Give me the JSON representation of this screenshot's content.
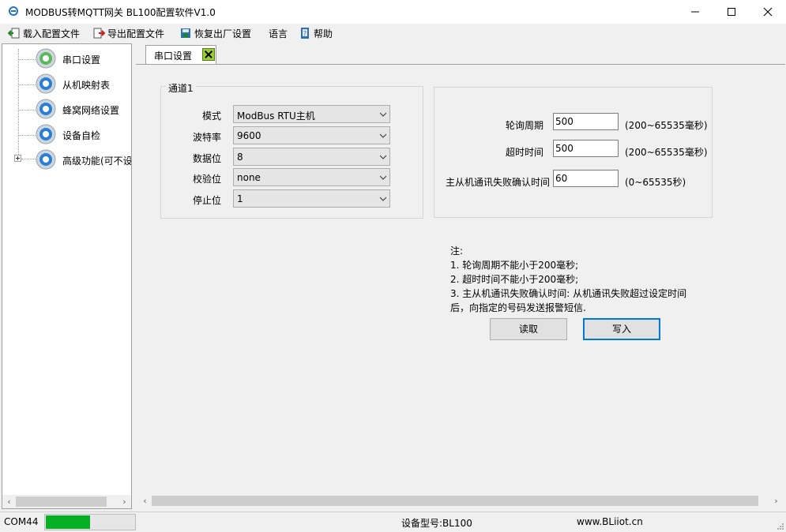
{
  "window": {
    "title": "MODBUS转MQTT网关 BL100配置软件V1.0",
    "icon": "app-logo-icon",
    "controls": [
      "minimize-icon",
      "maximize-icon",
      "close-icon"
    ]
  },
  "menu": {
    "items": [
      {
        "label": "载入配置文件",
        "icon": "load-file-icon"
      },
      {
        "label": "导出配置文件",
        "icon": "export-file-icon"
      },
      {
        "label": "恢复出厂设置",
        "icon": "restore-icon"
      },
      {
        "label": "语言",
        "icon": ""
      },
      {
        "label": "帮助",
        "icon": "help-book-icon"
      }
    ]
  },
  "tree": {
    "items": [
      {
        "label": "串口设置",
        "icon": "gear-green-icon"
      },
      {
        "label": "从机映射表",
        "icon": "gear-blue-icon"
      },
      {
        "label": "蜂窝网络设置",
        "icon": "gear-blue-icon"
      },
      {
        "label": "设备自检",
        "icon": "gear-blue-icon"
      },
      {
        "label": "高级功能(可不设",
        "icon": "gear-blue-icon"
      }
    ]
  },
  "tab": {
    "label": "串口设置",
    "close_icon": "tab-close-icon"
  },
  "channel": {
    "title": "通道1",
    "fields": [
      {
        "label": "模式",
        "value": "ModBus RTU主机"
      },
      {
        "label": "波特率",
        "value": "9600"
      },
      {
        "label": "数据位",
        "value": "8"
      },
      {
        "label": "校验位",
        "value": "none"
      },
      {
        "label": "停止位",
        "value": "1"
      }
    ]
  },
  "polling": {
    "fields": [
      {
        "label": "轮询周期",
        "value": "500",
        "range": "(200~65535毫秒)"
      },
      {
        "label": "超时时间",
        "value": "500",
        "range": "(200~65535毫秒)"
      },
      {
        "label": "主从机通讯失败确认时间",
        "value": "60",
        "range": "(0~65535秒)"
      }
    ]
  },
  "notes": {
    "lines": [
      "注:",
      "1. 轮询周期不能小于200毫秒;",
      "2. 超时时间不能小于200毫秒;",
      "3. 主从机通讯失败确认时间: 从机通讯失败超过设定时间",
      "后，向指定的号码发送报警短信."
    ]
  },
  "buttons": {
    "read": "读取",
    "write": "写入"
  },
  "status": {
    "port": "COM44",
    "progress": 0.5,
    "progress_color": "#06b025",
    "model": "设备型号:BL100",
    "website": "www.BLiiot.cn"
  }
}
